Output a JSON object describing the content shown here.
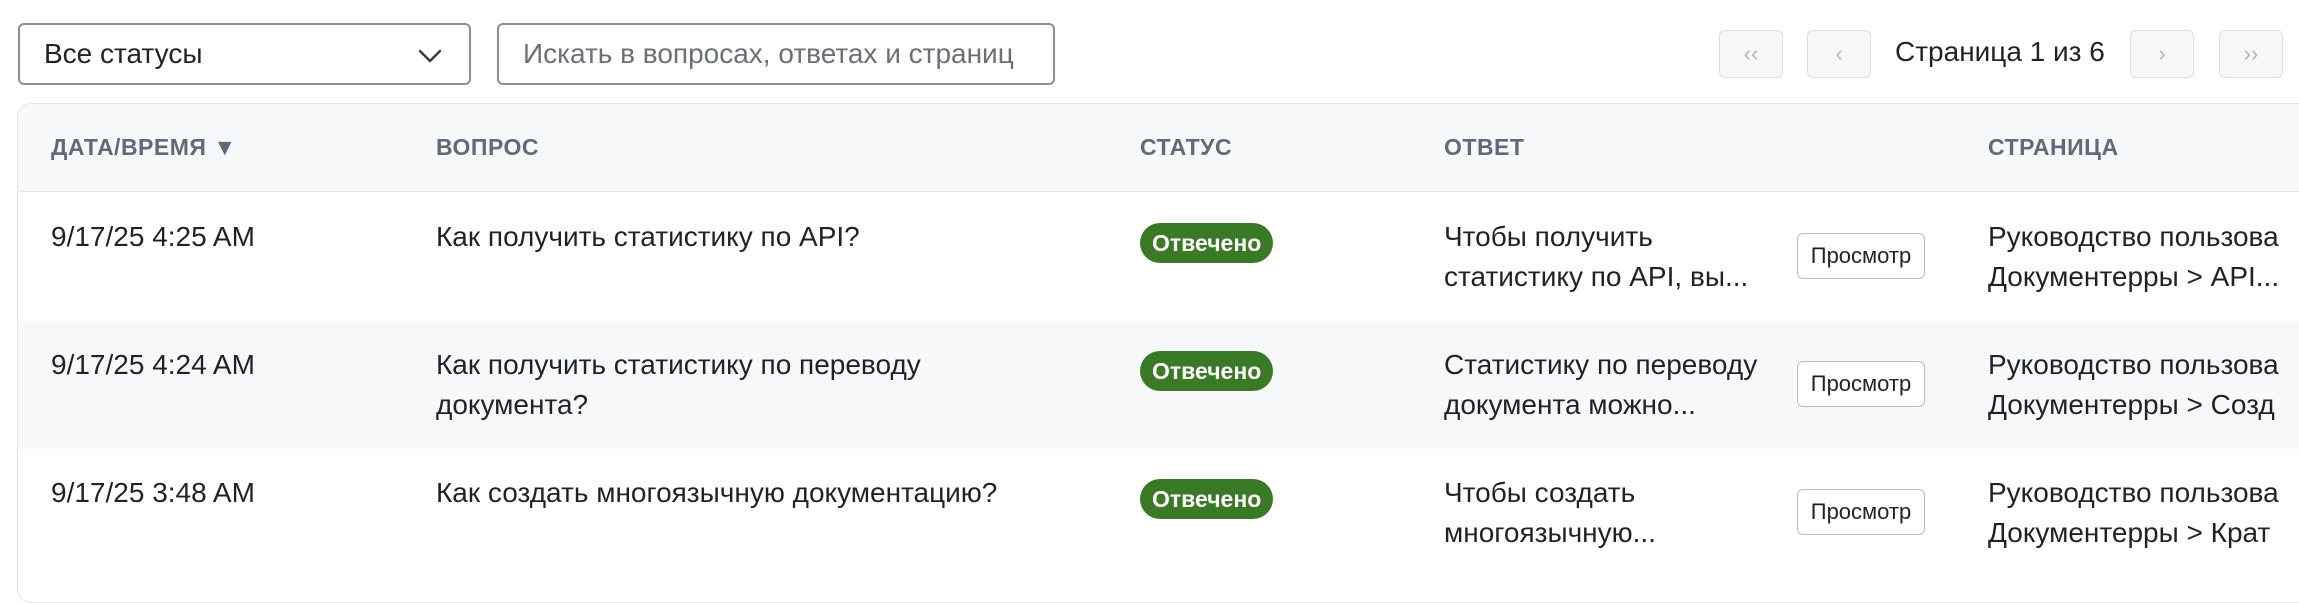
{
  "toolbar": {
    "status_filter": "Все статусы",
    "search_placeholder": "Искать в вопросах, ответах и страниц",
    "pager": {
      "first": "‹‹",
      "prev": "‹",
      "label": "Страница 1 из 6",
      "next": "›",
      "last": "››"
    }
  },
  "table": {
    "headers": {
      "datetime": "ДАТА/ВРЕМЯ ▼",
      "question": "ВОПРОС",
      "status": "СТАТУС",
      "answer": "ОТВЕТ",
      "page": "СТРАНИЦА"
    },
    "view_label": "Просмотр",
    "rows": [
      {
        "datetime": "9/17/25 4:25 AM",
        "question": "Как получить статистику по API?",
        "status": "Отвечено",
        "answer": "Чтобы получить статистику по API, вы...",
        "page_line1": "Руководство пользова",
        "page_line2": "Документерры > API..."
      },
      {
        "datetime": "9/17/25 4:24 AM",
        "question": "Как получить статистику по переводу документа?",
        "status": "Отвечено",
        "answer": "Статистику по переводу документа можно...",
        "page_line1": "Руководство пользова",
        "page_line2": "Документерры > Созд"
      },
      {
        "datetime": "9/17/25 3:48 AM",
        "question": "Как создать многоязычную документацию?",
        "status": "Отвечено",
        "answer": "Чтобы создать многоязычную...",
        "page_line1": "Руководство пользова",
        "page_line2": "Документерры > Крат"
      }
    ]
  },
  "colors": {
    "badge_answered": "#3a7a26",
    "header_text": "#5f6b7a",
    "alt_row": "#f7f8fa"
  }
}
